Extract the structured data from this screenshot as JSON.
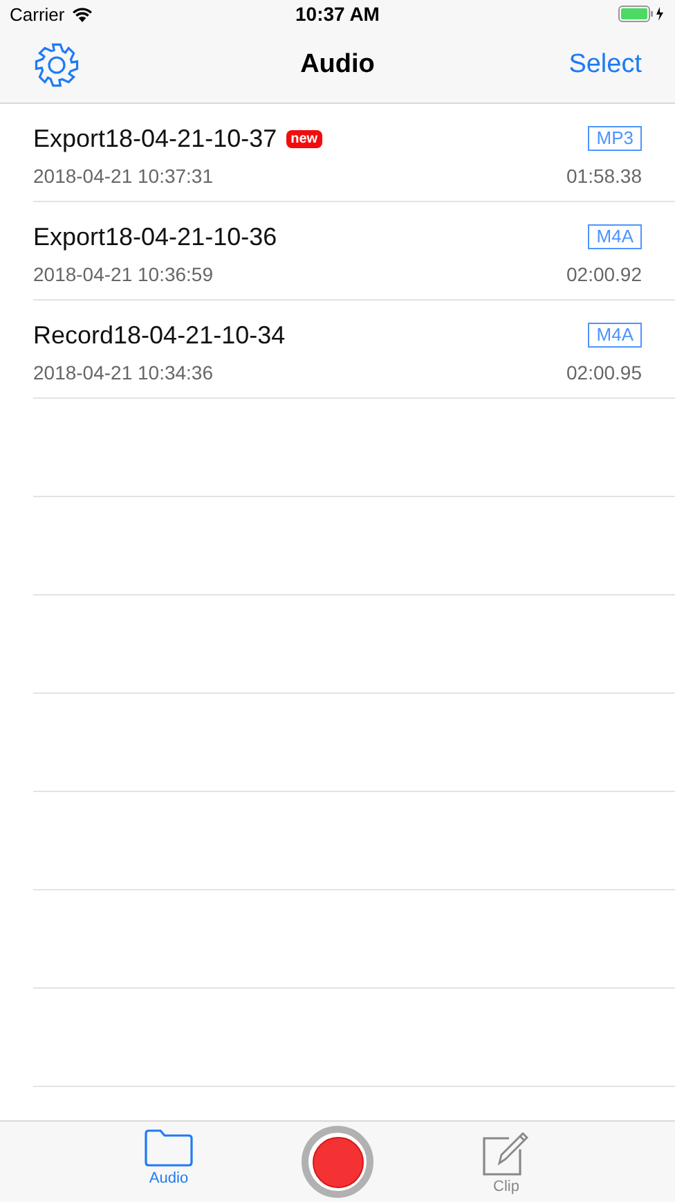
{
  "status_bar": {
    "carrier": "Carrier",
    "time": "10:37 AM"
  },
  "nav_bar": {
    "title": "Audio",
    "right_button": "Select"
  },
  "recordings": [
    {
      "name": "Export18-04-21-10-37",
      "badge": "new",
      "format": "MP3",
      "date": "2018-04-21 10:37:31",
      "duration": "01:58.38"
    },
    {
      "name": "Export18-04-21-10-36",
      "format": "M4A",
      "date": "2018-04-21 10:36:59",
      "duration": "02:00.92"
    },
    {
      "name": "Record18-04-21-10-34",
      "format": "M4A",
      "date": "2018-04-21 10:34:36",
      "duration": "02:00.95"
    }
  ],
  "tab_bar": [
    {
      "kind": "folder",
      "label": "Audio",
      "selected": true
    },
    {
      "kind": "record"
    },
    {
      "kind": "edit",
      "label": "Clip",
      "selected": false
    }
  ]
}
